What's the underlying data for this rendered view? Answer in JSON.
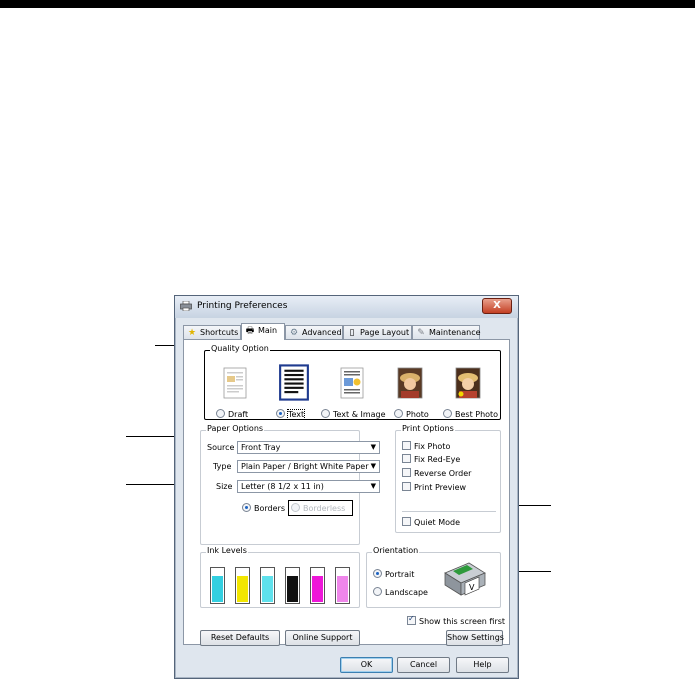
{
  "window": {
    "title": "Printing Preferences",
    "close_label": "X"
  },
  "tabs": [
    {
      "label": "Shortcuts",
      "icon": "star-icon"
    },
    {
      "label": "Main",
      "icon": "printer-icon"
    },
    {
      "label": "Advanced",
      "icon": "gears-icon"
    },
    {
      "label": "Page Layout",
      "icon": "page-icon"
    },
    {
      "label": "Maintenance",
      "icon": "wrench-icon"
    }
  ],
  "quality": {
    "legend": "Quality Option",
    "options": [
      {
        "label": "Draft",
        "selected": false
      },
      {
        "label": "Text",
        "selected": true
      },
      {
        "label": "Text & Image",
        "selected": false
      },
      {
        "label": "Photo",
        "selected": false
      },
      {
        "label": "Best Photo",
        "selected": false
      }
    ]
  },
  "paper": {
    "legend": "Paper Options",
    "source_label": "Source",
    "source_value": "Front Tray",
    "type_label": "Type",
    "type_value": "Plain Paper / Bright White Paper",
    "size_label": "Size",
    "size_value": "Letter (8 1/2 x 11 in)",
    "borders_label": "Borders",
    "borderless_label": "Borderless"
  },
  "print_options": {
    "legend": "Print Options",
    "items": [
      {
        "label": "Fix Photo",
        "checked": false
      },
      {
        "label": "Fix Red-Eye",
        "checked": false
      },
      {
        "label": "Reverse Order",
        "checked": false
      },
      {
        "label": "Print Preview",
        "checked": false
      }
    ],
    "quiet_mode": "Quiet Mode"
  },
  "ink": {
    "legend": "Ink Levels",
    "colors": [
      "#33cfe0",
      "#f2e600",
      "#5fe1ec",
      "#111111",
      "#ee17d8",
      "#ef86ea"
    ]
  },
  "orientation": {
    "legend": "Orientation",
    "portrait": "Portrait",
    "landscape": "Landscape"
  },
  "show_first": "Show this screen first",
  "buttons": {
    "reset": "Reset Defaults",
    "online": "Online Support",
    "show_settings": "Show Settings",
    "ok": "OK",
    "cancel": "Cancel",
    "help": "Help"
  }
}
